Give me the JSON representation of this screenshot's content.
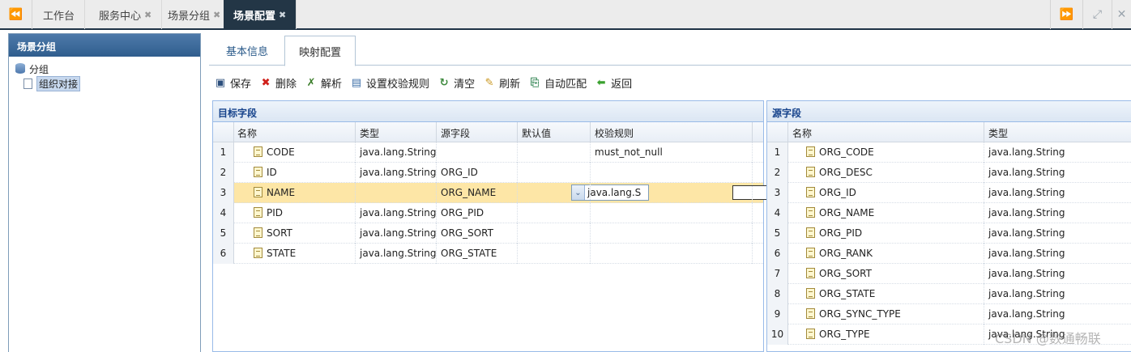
{
  "top_tabs": [
    {
      "label": "工作台",
      "closable": false,
      "active": false
    },
    {
      "label": "服务中心",
      "closable": true,
      "active": false
    },
    {
      "label": "场景分组",
      "closable": true,
      "active": false
    },
    {
      "label": "场景配置",
      "closable": true,
      "active": true
    }
  ],
  "left_panel": {
    "title": "场景分组",
    "tree": {
      "root_label": "分组",
      "child_label": "组织对接"
    }
  },
  "main_tabs": [
    {
      "label": "基本信息",
      "active": false
    },
    {
      "label": "映射配置",
      "active": true
    }
  ],
  "toolbar": {
    "save": "保存",
    "delete": "删除",
    "parse": "解析",
    "set_rules": "设置校验规则",
    "clear": "清空",
    "refresh": "刷新",
    "auto_match": "自动匹配",
    "back": "返回"
  },
  "target_grid": {
    "title": "目标字段",
    "columns": {
      "name": "名称",
      "type": "类型",
      "source": "源字段",
      "default": "默认值",
      "rule": "校验规则"
    },
    "rows": [
      {
        "n": "1",
        "name": "CODE",
        "type": "java.lang.String",
        "source": "",
        "default": "",
        "rule": "must_not_null"
      },
      {
        "n": "2",
        "name": "ID",
        "type": "java.lang.String",
        "source": "ORG_ID",
        "default": "",
        "rule": ""
      },
      {
        "n": "3",
        "name": "NAME",
        "type": "java.lang.S",
        "source": "ORG_NAME",
        "default": "",
        "rule": ""
      },
      {
        "n": "4",
        "name": "PID",
        "type": "java.lang.String",
        "source": "ORG_PID",
        "default": "",
        "rule": ""
      },
      {
        "n": "5",
        "name": "SORT",
        "type": "java.lang.String",
        "source": "ORG_SORT",
        "default": "",
        "rule": ""
      },
      {
        "n": "6",
        "name": "STATE",
        "type": "java.lang.String",
        "source": "ORG_STATE",
        "default": "",
        "rule": ""
      }
    ]
  },
  "source_grid": {
    "title": "源字段",
    "columns": {
      "name": "名称",
      "type": "类型"
    },
    "rows": [
      {
        "n": "1",
        "name": "ORG_CODE",
        "type": "java.lang.String"
      },
      {
        "n": "2",
        "name": "ORG_DESC",
        "type": "java.lang.String"
      },
      {
        "n": "3",
        "name": "ORG_ID",
        "type": "java.lang.String"
      },
      {
        "n": "4",
        "name": "ORG_NAME",
        "type": "java.lang.String"
      },
      {
        "n": "5",
        "name": "ORG_PID",
        "type": "java.lang.String"
      },
      {
        "n": "6",
        "name": "ORG_RANK",
        "type": "java.lang.String"
      },
      {
        "n": "7",
        "name": "ORG_SORT",
        "type": "java.lang.String"
      },
      {
        "n": "8",
        "name": "ORG_STATE",
        "type": "java.lang.String"
      },
      {
        "n": "9",
        "name": "ORG_SYNC_TYPE",
        "type": "java.lang.String"
      },
      {
        "n": "10",
        "name": "ORG_TYPE",
        "type": "java.lang.String"
      }
    ]
  },
  "watermark": "CSDN @数通畅联",
  "colors": {
    "accent": "#233646",
    "selected_row": "#fde6a6",
    "panel_header": "#2f5d8d"
  }
}
